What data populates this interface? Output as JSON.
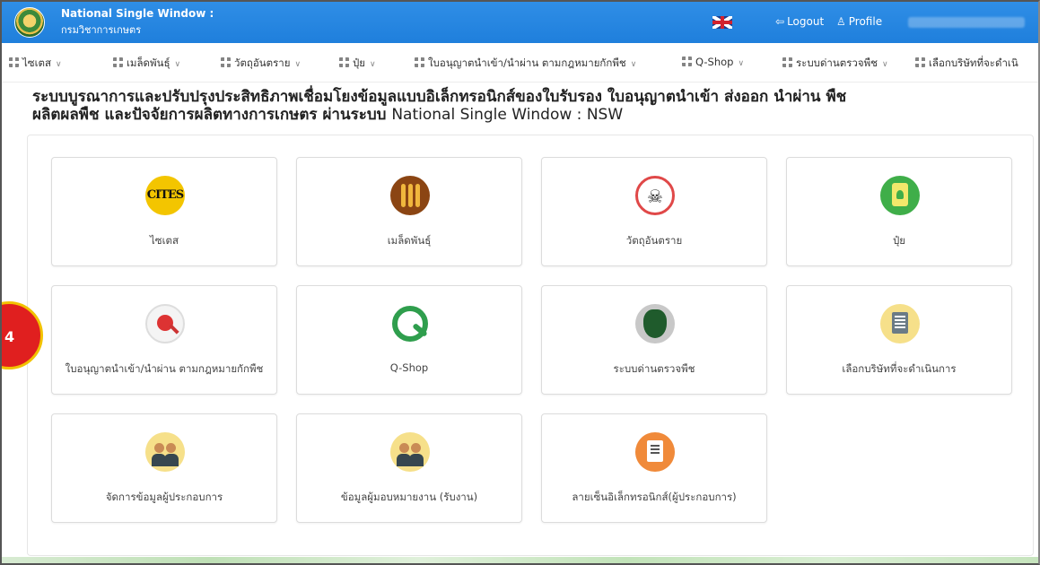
{
  "header": {
    "title": "National Single Window :",
    "subtitle": "กรมวิชาการเกษตร",
    "logout_label": "Logout",
    "profile_label": "Profile",
    "logout_icon": "logout-icon",
    "profile_icon": "profile-icon",
    "flag_icon": "uk-flag-icon",
    "bar_color": "#1f7fdc"
  },
  "menu": {
    "items": [
      {
        "label": "ไซเตส"
      },
      {
        "label": "เมล็ดพันธุ์"
      },
      {
        "label": "วัตถุอันตราย"
      },
      {
        "label": "ปุ๋ย"
      },
      {
        "label": "ใบอนุญาตนำเข้า/นำผ่าน ตามกฎหมายกักพืช"
      },
      {
        "label": "Q-Shop"
      },
      {
        "label": "ระบบด่านตรวจพืช"
      },
      {
        "label": "เลือกบริษัทที่จะดำเนิ"
      }
    ]
  },
  "page": {
    "heading_line1": "ระบบบูรณาการและปรับปรุงประสิทธิภาพเชื่อมโยงข้อมูลแบบอิเล็กทรอนิกส์ของใบรับรอง ใบอนุญาตนำเข้า ส่งออก นำผ่าน พืช",
    "heading_line2": "ผลิตผลพืช และปัจจัยการผลิตทางการเกษตร ผ่านระบบ",
    "heading_suffix": "National Single Window : NSW"
  },
  "cards": [
    {
      "label": "ไซเตส",
      "icon": "cites-icon",
      "icon_text": "CITES"
    },
    {
      "label": "เมล็ดพันธุ์",
      "icon": "seed-icon"
    },
    {
      "label": "วัตถุอันตราย",
      "icon": "hazard-icon",
      "icon_text": "☠"
    },
    {
      "label": "ปุ๋ย",
      "icon": "fertilizer-icon"
    },
    {
      "label": "ใบอนุญาตนำเข้า/นำผ่าน ตามกฎหมายกักพืช",
      "icon": "plant-quarantine-icon"
    },
    {
      "label": "Q-Shop",
      "icon": "qshop-icon"
    },
    {
      "label": "ระบบด่านตรวจพืช",
      "icon": "plant-checkpoint-icon"
    },
    {
      "label": "เลือกบริษัทที่จะดำเนินการ",
      "icon": "select-company-icon"
    },
    {
      "label": "จัดการข้อมูลผู้ประกอบการ",
      "icon": "manage-operator-icon"
    },
    {
      "label": "ข้อมูลผู้มอบหมายงาน (รับงาน)",
      "icon": "assignor-info-icon"
    },
    {
      "label": "ลายเซ็นอิเล็กทรอนิกส์(ผู้ประกอบการ)",
      "icon": "e-signature-icon"
    }
  ],
  "annotation": {
    "text": "4",
    "color": "#e01f1f"
  }
}
